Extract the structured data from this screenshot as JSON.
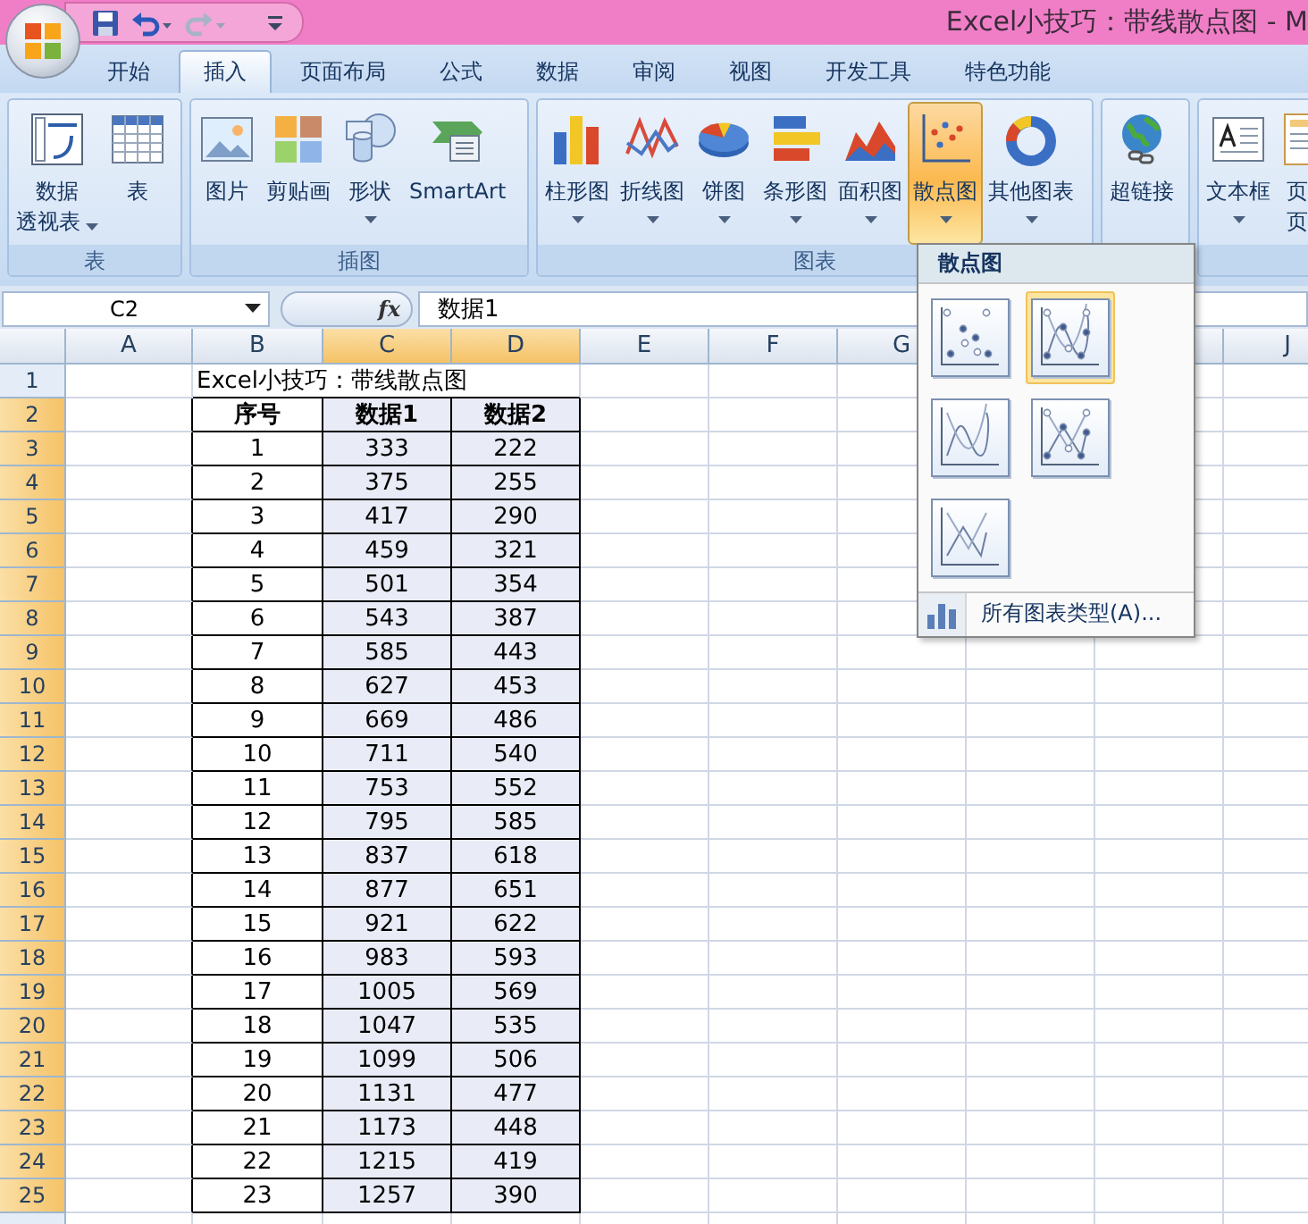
{
  "window": {
    "title": "Excel小技巧：带线散点图 - M"
  },
  "tabs": [
    {
      "label": "开始",
      "selected": false
    },
    {
      "label": "插入",
      "selected": true
    },
    {
      "label": "页面布局",
      "selected": false
    },
    {
      "label": "公式",
      "selected": false
    },
    {
      "label": "数据",
      "selected": false
    },
    {
      "label": "审阅",
      "selected": false
    },
    {
      "label": "视图",
      "selected": false
    },
    {
      "label": "开发工具",
      "selected": false
    },
    {
      "label": "特色功能",
      "selected": false
    }
  ],
  "ribbon": [
    {
      "label": "表",
      "buttons": [
        {
          "lines": [
            "数据",
            "透视表"
          ],
          "dropdown": true,
          "pressed": false
        },
        {
          "lines": [
            "表"
          ],
          "dropdown": false,
          "pressed": false
        }
      ]
    },
    {
      "label": "插图",
      "buttons": [
        {
          "lines": [
            "图片"
          ],
          "dropdown": false,
          "pressed": false
        },
        {
          "lines": [
            "剪贴画"
          ],
          "dropdown": false,
          "pressed": false
        },
        {
          "lines": [
            "形状"
          ],
          "dropdown": true,
          "pressed": false
        },
        {
          "lines": [
            "SmartArt"
          ],
          "dropdown": false,
          "pressed": false
        }
      ]
    },
    {
      "label": "图表",
      "buttons": [
        {
          "lines": [
            "柱形图"
          ],
          "dropdown": true,
          "pressed": false
        },
        {
          "lines": [
            "折线图"
          ],
          "dropdown": true,
          "pressed": false
        },
        {
          "lines": [
            "饼图"
          ],
          "dropdown": true,
          "pressed": false
        },
        {
          "lines": [
            "条形图"
          ],
          "dropdown": true,
          "pressed": false
        },
        {
          "lines": [
            "面积图"
          ],
          "dropdown": true,
          "pressed": false
        },
        {
          "lines": [
            "散点图"
          ],
          "dropdown": true,
          "pressed": true
        },
        {
          "lines": [
            "其他图表"
          ],
          "dropdown": true,
          "pressed": false
        }
      ]
    },
    {
      "buttons": [
        {
          "lines": [
            "超链接"
          ],
          "dropdown": false,
          "pressed": false
        }
      ]
    },
    {
      "buttons": [
        {
          "lines": [
            "文本框"
          ],
          "dropdown": true,
          "pressed": false
        },
        {
          "lines": [
            "页",
            "页"
          ],
          "dropdown": false,
          "pressed": false
        }
      ]
    }
  ],
  "formula_bar": {
    "name_box": "C2",
    "function_label": "fx",
    "formula": "数据1"
  },
  "columns": [
    {
      "label": "A",
      "selected": false
    },
    {
      "label": "B",
      "selected": false
    },
    {
      "label": "C",
      "selected": true
    },
    {
      "label": "D",
      "selected": true
    },
    {
      "label": "E",
      "selected": false
    },
    {
      "label": "F",
      "selected": false
    },
    {
      "label": "G",
      "selected": false
    },
    {
      "label": "J",
      "selected": false
    }
  ],
  "rows": [
    {
      "number": "1",
      "selected": false
    },
    {
      "number": "2",
      "selected": true
    },
    {
      "number": "3",
      "selected": true
    },
    {
      "number": "4",
      "selected": true
    },
    {
      "number": "5",
      "selected": true
    },
    {
      "number": "6",
      "selected": true
    },
    {
      "number": "7",
      "selected": true
    },
    {
      "number": "8",
      "selected": true
    },
    {
      "number": "9",
      "selected": true
    },
    {
      "number": "10",
      "selected": true
    },
    {
      "number": "11",
      "selected": true
    },
    {
      "number": "12",
      "selected": true
    },
    {
      "number": "13",
      "selected": true
    },
    {
      "number": "14",
      "selected": true
    },
    {
      "number": "15",
      "selected": true
    },
    {
      "number": "16",
      "selected": true
    },
    {
      "number": "17",
      "selected": true
    },
    {
      "number": "18",
      "selected": true
    },
    {
      "number": "19",
      "selected": true
    },
    {
      "number": "20",
      "selected": true
    },
    {
      "number": "21",
      "selected": true
    },
    {
      "number": "22",
      "selected": true
    },
    {
      "number": "23",
      "selected": true
    },
    {
      "number": "24",
      "selected": true
    },
    {
      "number": "25",
      "selected": true
    }
  ],
  "sheet": {
    "title": "Excel小技巧：带线散点图",
    "header": [
      "序号",
      "数据1",
      "数据2"
    ],
    "data": [
      [
        "1",
        "333",
        "222"
      ],
      [
        "2",
        "375",
        "255"
      ],
      [
        "3",
        "417",
        "290"
      ],
      [
        "4",
        "459",
        "321"
      ],
      [
        "5",
        "501",
        "354"
      ],
      [
        "6",
        "543",
        "387"
      ],
      [
        "7",
        "585",
        "443"
      ],
      [
        "8",
        "627",
        "453"
      ],
      [
        "9",
        "669",
        "486"
      ],
      [
        "10",
        "711",
        "540"
      ],
      [
        "11",
        "753",
        "552"
      ],
      [
        "12",
        "795",
        "585"
      ],
      [
        "13",
        "837",
        "618"
      ],
      [
        "14",
        "877",
        "651"
      ],
      [
        "15",
        "921",
        "622"
      ],
      [
        "16",
        "983",
        "593"
      ],
      [
        "17",
        "1005",
        "569"
      ],
      [
        "18",
        "1047",
        "535"
      ],
      [
        "19",
        "1099",
        "506"
      ],
      [
        "20",
        "1131",
        "477"
      ],
      [
        "21",
        "1173",
        "448"
      ],
      [
        "22",
        "1215",
        "419"
      ],
      [
        "23",
        "1257",
        "390"
      ]
    ]
  },
  "menu": {
    "title": "散点图",
    "options": [
      {
        "kind": "markers",
        "selected": false
      },
      {
        "kind": "smoothmarkers",
        "selected": true
      },
      {
        "kind": "smooth",
        "selected": false
      },
      {
        "kind": "straightmarkers",
        "selected": false
      },
      {
        "kind": "straight",
        "selected": false
      }
    ],
    "footer": "所有图表类型(A)..."
  }
}
